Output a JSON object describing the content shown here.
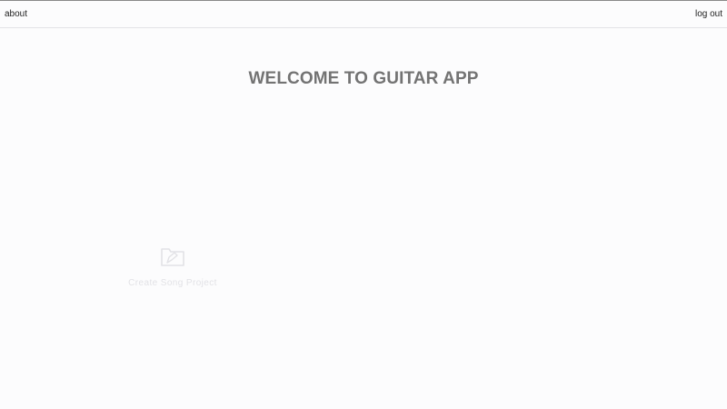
{
  "topbar": {
    "about_label": "about",
    "logout_label": "log out"
  },
  "main": {
    "title": "WELCOME TO GUITAR APP",
    "create_project": {
      "label": "Create Song Project",
      "icon": "folder-edit-icon"
    }
  },
  "colors": {
    "background": "#fcfcfd",
    "title": "#737373",
    "faded": "#e2e2e6",
    "link": "#1e1e1e"
  }
}
